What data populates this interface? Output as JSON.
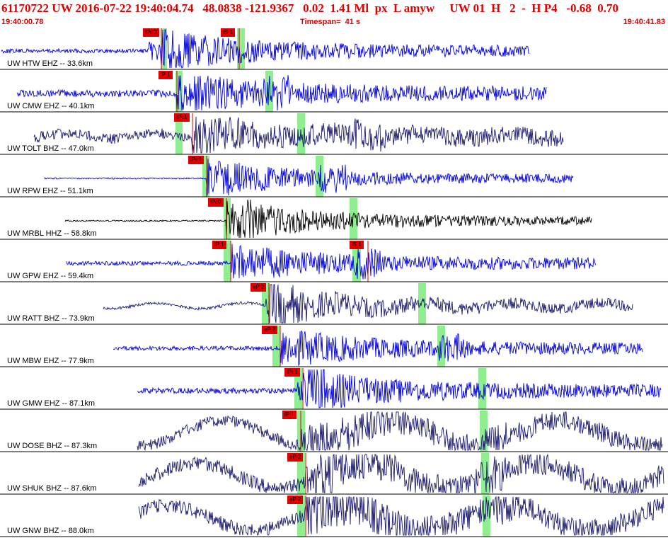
{
  "header": {
    "title": "61170722 UW 2016-07-22 19:40:04.74   48.0838 -121.9367   0.02  1.41 Ml  px  L amyw     UW 01  H   2  -  H P4   -0.68  0.70",
    "start_time": "19:40:00.78",
    "timespan": "Timespan=  41 s",
    "end_time": "19:40:41.83"
  },
  "colors": {
    "header_text": "#e00000",
    "trace_blue": "#0000e0",
    "trace_navy": "#1a1a70",
    "trace_black": "#000000",
    "pick_box": "#e00000",
    "window_band": "#90ee90",
    "divider": "#000000"
  },
  "traces": [
    {
      "label": "UW HTW EHZ -- 33.6km",
      "color": "blue",
      "pick_labels": [
        "iPdD",
        "iS 1"
      ]
    },
    {
      "label": "UW CMW EHZ -- 40.1km",
      "color": "blue",
      "pick_labels": [
        "iP 1"
      ]
    },
    {
      "label": "UW TOLT BHZ -- 47.0km",
      "color": "navy",
      "pick_labels": [
        "iPc1"
      ]
    },
    {
      "label": "UW RPW EHZ -- 51.1km",
      "color": "blue",
      "pick_labels": [
        "iPd1"
      ]
    },
    {
      "label": "UW MRBL HHZ -- 58.8km",
      "color": "black",
      "pick_labels": [
        "iPc0"
      ]
    },
    {
      "label": "UW GPW EHZ -- 59.4km",
      "color": "blue",
      "pick_labels": [
        "iP 1",
        "iS 1"
      ]
    },
    {
      "label": "UW RATT BHZ -- 73.9km",
      "color": "navy",
      "pick_labels": [
        "eP 2"
      ]
    },
    {
      "label": "UW MBW EHZ -- 77.9km",
      "color": "blue",
      "pick_labels": [
        "eP 2"
      ]
    },
    {
      "label": "UW GMW EHZ -- 87.1km",
      "color": "blue",
      "pick_labels": [
        "iPc1"
      ]
    },
    {
      "label": "UW DOSE BHZ -- 87.3km",
      "color": "navy",
      "pick_labels": [
        "iP 1"
      ]
    },
    {
      "label": "UW SHUK BHZ -- 87.6km",
      "color": "navy",
      "pick_labels": [
        "eP 2"
      ]
    },
    {
      "label": "UW GNW BHZ -- 88.0km",
      "color": "navy",
      "pick_labels": [
        "eP 2"
      ]
    }
  ]
}
